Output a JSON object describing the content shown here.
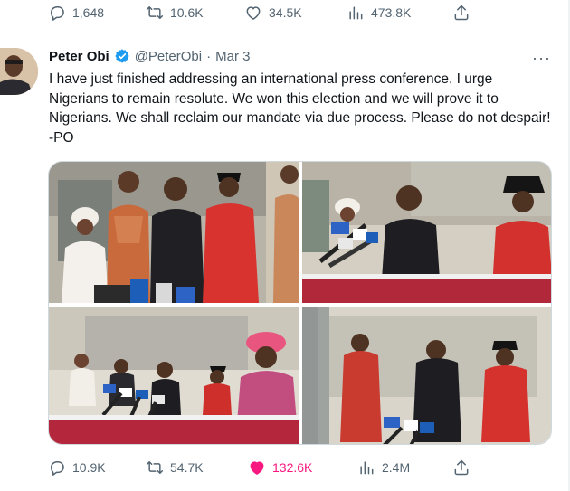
{
  "previous_tweet": {
    "actions": {
      "reply_count": "1,648",
      "retweet_count": "10.6K",
      "like_count": "34.5K",
      "view_count": "473.8K"
    }
  },
  "tweet": {
    "author_name": "Peter Obi",
    "handle": "@PeterObi",
    "separator": "·",
    "date": "Mar 3",
    "more_glyph": "···",
    "text": "I have just finished addressing an international press conference. I urge Nigerians to remain resolute. We won this election and we will prove it to Nigerians. We shall reclaim our mandate via due process. Please do not despair! -PO",
    "actions": {
      "reply_count": "10.9K",
      "retweet_count": "54.7K",
      "like_count": "132.6K",
      "view_count": "2.4M"
    },
    "liked": true
  },
  "colors": {
    "text_primary": "#0f1419",
    "text_secondary": "#536471",
    "verified_badge": "#1d9bf0",
    "like_active": "#f91880",
    "divider": "#eff3f4"
  },
  "icons": [
    "reply-icon",
    "retweet-icon",
    "like-icon",
    "views-icon",
    "share-icon",
    "verified-badge-icon",
    "more-options-icon"
  ]
}
